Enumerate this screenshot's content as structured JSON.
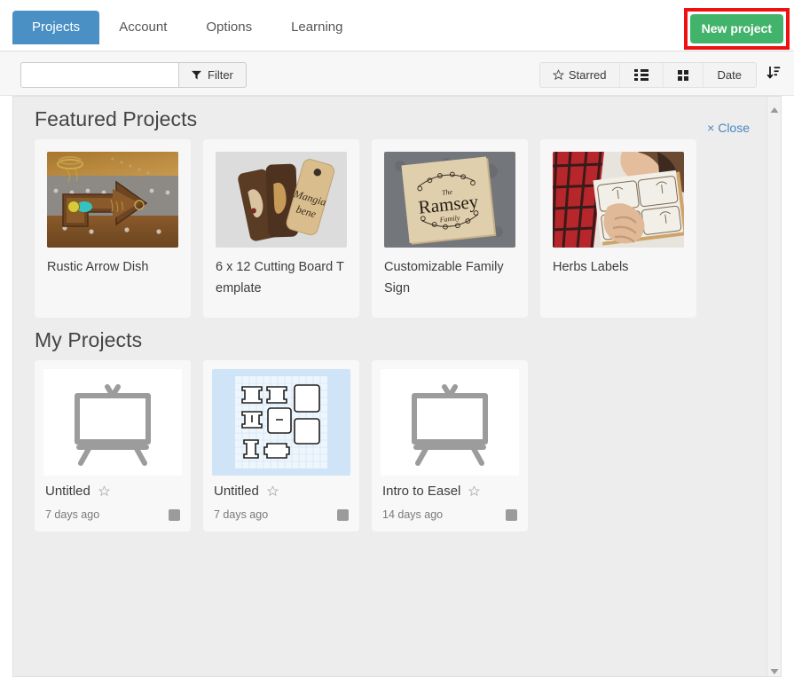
{
  "tabs": [
    {
      "label": "Projects",
      "active": true
    },
    {
      "label": "Account",
      "active": false
    },
    {
      "label": "Options",
      "active": false
    },
    {
      "label": "Learning",
      "active": false
    }
  ],
  "header": {
    "new_project_label": "New project",
    "new_project_color": "#42b36a",
    "highlight_color": "#ee1111",
    "active_tab_color": "#4a90c4"
  },
  "toolbar": {
    "search_value": "",
    "search_placeholder": "",
    "filter_label": "Filter",
    "filter_icon": "funnel-icon",
    "starred_label": "Starred",
    "starred_icon": "star-outline-icon",
    "list_view_icon": "list-view-icon",
    "grid_view_icon": "grid-view-icon",
    "sort_label": "Date",
    "sort_icon": "sort-descending-icon"
  },
  "featured": {
    "title": "Featured Projects",
    "close_label": "× Close",
    "close_color": "#4a86c4",
    "projects": [
      {
        "title": "Rustic Arrow Dish",
        "thumb": "rustic-arrow-dish-photo"
      },
      {
        "title": "6 x 12 Cutting Board Template",
        "thumb": "cutting-board-tags-photo"
      },
      {
        "title": "Customizable Family Sign",
        "thumb": "ramsey-family-sign-photo"
      },
      {
        "title": "Herbs Labels",
        "thumb": "herbs-labels-photo"
      }
    ]
  },
  "my_projects": {
    "title": "My Projects",
    "projects": [
      {
        "title": "Untitled",
        "date": "7 days ago",
        "thumb": "easel-placeholder-icon",
        "starred": false
      },
      {
        "title": "Untitled",
        "date": "7 days ago",
        "thumb": "cnc-layout-preview",
        "starred": false
      },
      {
        "title": "Intro to Easel",
        "date": "14 days ago",
        "thumb": "easel-placeholder-icon",
        "starred": false
      }
    ]
  },
  "scrollbar": {
    "up_icon": "caret-up-icon",
    "down_icon": "caret-down-icon"
  }
}
